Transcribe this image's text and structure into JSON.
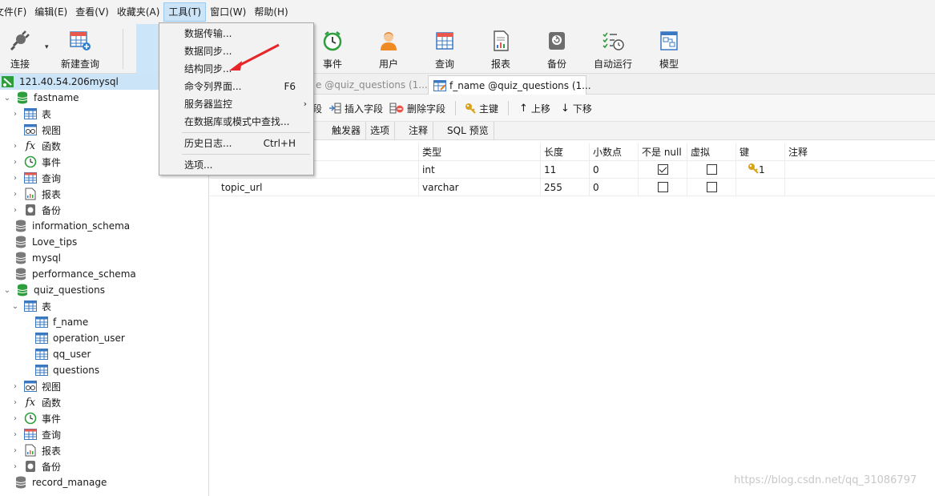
{
  "menubar": {
    "items": [
      "文件(F)",
      "编辑(E)",
      "查看(V)",
      "收藏夹(A)",
      "工具(T)",
      "窗口(W)",
      "帮助(H)"
    ]
  },
  "toolbar": {
    "connect": "连接",
    "new_query": "新建查询",
    "event": "事件",
    "user": "用户",
    "query": "查询",
    "report": "报表",
    "backup": "备份",
    "auto_run": "自动运行",
    "model": "模型"
  },
  "tools_menu": {
    "items": [
      {
        "label": "数据传输..."
      },
      {
        "label": "数据同步..."
      },
      {
        "label": "结构同步..."
      },
      {
        "label": "命令列界面...",
        "shortcut": "F6"
      },
      {
        "label": "服务器监控"
      },
      {
        "label": "在数据库或模式中查找..."
      },
      {
        "label": "历史日志...",
        "shortcut": "Ctrl+H"
      },
      {
        "label": "选项..."
      }
    ]
  },
  "navigator": {
    "connection": "121.40.54.206mysql",
    "db_fastname": "fastname",
    "tables": "表",
    "views": "视图",
    "functions": "函数",
    "events": "事件",
    "queries": "查询",
    "reports": "报表",
    "backups": "备份",
    "db_information_schema": "information_schema",
    "db_love_tips": "Love_tips",
    "db_mysql": "mysql",
    "db_performance_schema": "performance_schema",
    "db_quiz_questions": "quiz_questions",
    "table_f_name": "f_name",
    "table_operation_user": "operation_user",
    "table_qq_user": "qq_user",
    "table_questions": "questions",
    "db_record_manage": "record_manage"
  },
  "tabs": {
    "tab1": "e @quiz_questions (1...",
    "tab2": "f_name @quiz_questions (1..."
  },
  "designer_toolbar": {
    "add_field": "段",
    "insert_field": "插入字段",
    "delete_field": "删除字段",
    "primary_key": "主键",
    "move_up": "上移",
    "move_down": "下移"
  },
  "subtabs": [
    "触发器",
    "选项",
    "注释",
    "SQL 预览"
  ],
  "grid": {
    "headers": {
      "type": "类型",
      "length": "长度",
      "decimals": "小数点",
      "not_null": "不是 null",
      "virtual": "虚拟",
      "key": "键",
      "comment": "注释"
    },
    "rows": [
      {
        "name": "",
        "type": "int",
        "length": "11",
        "decimals": "0",
        "not_null": true,
        "virtual": false,
        "key": "1",
        "comment": ""
      },
      {
        "name": "topic_url",
        "type": "varchar",
        "length": "255",
        "decimals": "0",
        "not_null": false,
        "virtual": false,
        "key": "",
        "comment": ""
      }
    ]
  },
  "watermark": "https://blog.csdn.net/qq_31086797",
  "colors": {
    "selection": "#cce4f7",
    "db_green": "#2e9e3c",
    "annotation_red": "#e8262a",
    "key_gold": "#d9a21b"
  }
}
